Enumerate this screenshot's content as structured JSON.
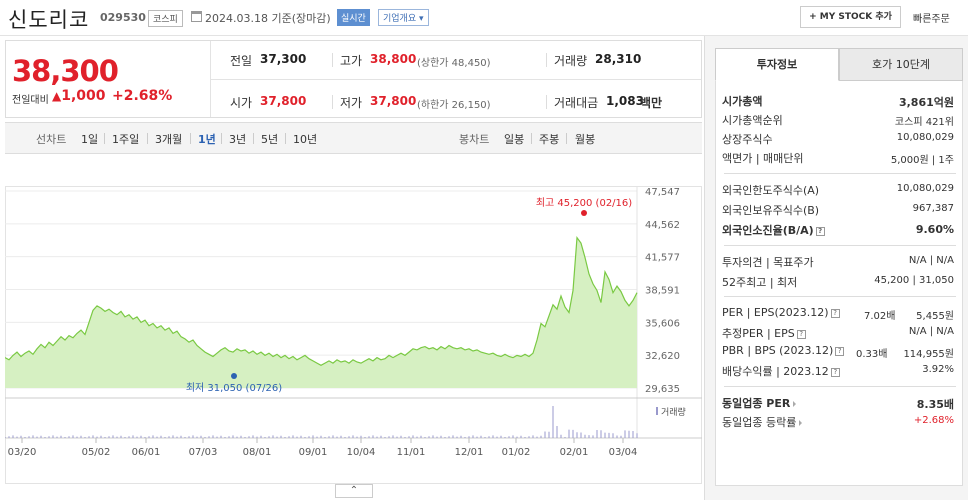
{
  "header": {
    "company_name": "신도리코",
    "code": "029530",
    "market": "코스피",
    "date_text": "2024.03.18 기준(장마감)",
    "realtime_label": "실시간",
    "company_info_label": "기업개요",
    "mystock_label": "+ MY STOCK 추가",
    "quick_order_label": "빠른주문"
  },
  "quote": {
    "current_price": "38,300",
    "change_label": "전일대비",
    "change_value": "1,000",
    "change_percent": "+2.68%",
    "prev_close_label": "전일",
    "prev_close": "37,300",
    "high_label": "고가",
    "high": "38,800",
    "upper_limit": "(상한가 48,450)",
    "volume_label": "거래량",
    "volume": "28,310",
    "open_label": "시가",
    "open": "37,800",
    "low_label": "저가",
    "low": "37,800",
    "lower_limit": "(하한가 26,150)",
    "trade_value_label": "거래대금",
    "trade_value": "1,083",
    "trade_value_unit": "백만"
  },
  "period_bar": {
    "line_chart_label": "선차트",
    "periods": [
      "1일",
      "1주일",
      "3개월",
      "1년",
      "3년",
      "5년",
      "10년"
    ],
    "selected_period": "1년",
    "candle_label": "봉차트",
    "candles": [
      "일봉",
      "주봉",
      "월봉"
    ]
  },
  "chart_data": {
    "type": "area",
    "y_ticks": [
      "47,547",
      "44,562",
      "41,577",
      "38,591",
      "35,606",
      "32,620",
      "29,635"
    ],
    "ylim": [
      29635,
      47547
    ],
    "x_ticks": [
      "03/20",
      "05/02",
      "06/01",
      "07/03",
      "08/01",
      "09/01",
      "10/04",
      "11/01",
      "12/01",
      "01/02",
      "02/01",
      "03/04"
    ],
    "values": [
      32400,
      32200,
      32600,
      32900,
      32500,
      32800,
      33000,
      32700,
      33200,
      33600,
      33300,
      33800,
      33500,
      33900,
      34300,
      34000,
      34400,
      34200,
      34600,
      34900,
      34500,
      35600,
      36700,
      37100,
      36900,
      36600,
      36800,
      36500,
      36300,
      36600,
      36100,
      36300,
      35900,
      36100,
      35600,
      35800,
      35300,
      35500,
      35100,
      35300,
      34900,
      35100,
      34600,
      34800,
      34300,
      34100,
      33800,
      34000,
      33500,
      33200,
      32900,
      32700,
      32500,
      32800,
      33100,
      33300,
      33000,
      32900,
      33200,
      33000,
      33100,
      32800,
      33000,
      32700,
      32900,
      32600,
      32800,
      32500,
      32700,
      32400,
      32600,
      32300,
      32500,
      32200,
      32400,
      32600,
      32300,
      32100,
      31900,
      31700,
      31900,
      32100,
      31900,
      32200,
      32000,
      32100,
      31900,
      32200,
      32000,
      31900,
      32100,
      32300,
      32100,
      32400,
      32200,
      32300,
      32600,
      32400,
      32600,
      32800,
      32600,
      32900,
      33200,
      33100,
      33300,
      33400,
      33200,
      33300,
      33100,
      33400,
      33200,
      33500,
      33300,
      33200,
      33300,
      33100,
      33200,
      33000,
      33100,
      32900,
      32800,
      32700,
      32800,
      32600,
      32500,
      32700,
      32500,
      32400,
      32600,
      32500,
      32700,
      32500,
      32800,
      34000,
      35500,
      35200,
      36200,
      37200,
      36800,
      38000,
      37000,
      36500,
      38500,
      43300,
      42800,
      41500,
      40000,
      39100,
      38500,
      37400,
      40200,
      39500,
      38300,
      38900,
      38400,
      37600,
      37100,
      37600,
      38300
    ],
    "volume_label": "거래량",
    "high_annotation": "최고 45,200 (02/16)",
    "low_annotation": "최저 31,050 (07/26)",
    "series_color": "#7ac943",
    "fill_color": "#d6f0c2"
  },
  "invest_info": {
    "tab_active": "투자정보",
    "tab_other": "호가 10단계",
    "market_cap_label": "시가총액",
    "market_cap": "3,861억원",
    "market_cap_rank_label": "시가총액순위",
    "market_cap_rank": "코스피 421위",
    "shares_label": "상장주식수",
    "shares": "10,080,029",
    "par_label": "액면가 | 매매단위",
    "par": "5,000원 | 1주",
    "foreign_limit_label": "외국인한도주식수(A)",
    "foreign_limit": "10,080,029",
    "foreign_held_label": "외국인보유주식수(B)",
    "foreign_held": "967,387",
    "foreign_rate_label": "외국인소진율(B/A)",
    "foreign_rate": "9.60%",
    "opinion_label": "투자의견 | 목표주가",
    "opinion": "N/A | N/A",
    "week52_label": "52주최고 | 최저",
    "week52": "45,200 | 31,050",
    "per_label": "PER | EPS(2023.12)",
    "per_value": "7.02배",
    "eps_value": "5,455원",
    "est_per_label": "추정PER | EPS",
    "est_per_value": "N/A | N/A",
    "pbr_label": "PBR | BPS (2023.12)",
    "pbr_value": "0.33배",
    "bps_value": "114,955원",
    "div_label": "배당수익률 | 2023.12",
    "div_value": "3.92%",
    "sector_per_label": "동일업종 PER",
    "sector_per": "8.35배",
    "sector_change_label": "동일업종 등락률",
    "sector_change": "+2.68%"
  }
}
